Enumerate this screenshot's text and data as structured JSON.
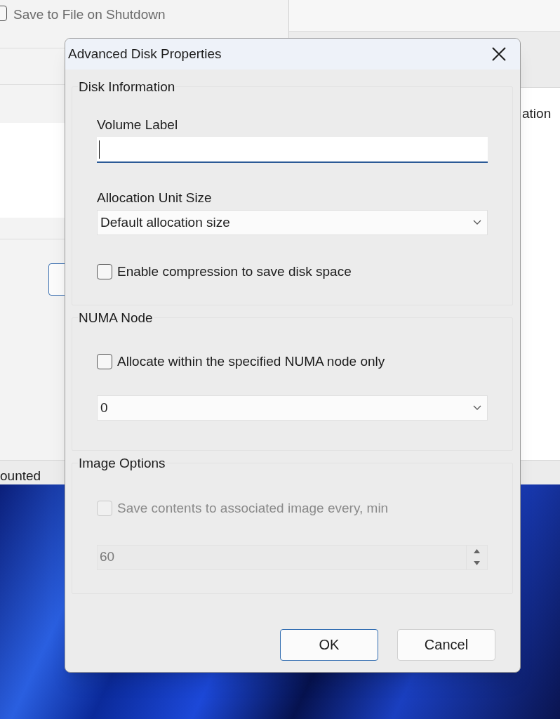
{
  "background": {
    "left_window": {
      "checkbox": {
        "label": "Save to File on Shutdown",
        "checked": false
      },
      "status_text": "ounted"
    },
    "right_window": {
      "text": "ation"
    }
  },
  "dialog": {
    "title": "Advanced Disk Properties",
    "groups": [
      {
        "title": "Disk Information",
        "items": [
          {
            "kind": "text_field",
            "label": "Volume Label",
            "focused": true
          },
          {
            "kind": "dropdown",
            "label": "Allocation Unit Size",
            "value": "Default allocation size"
          },
          {
            "kind": "checkbox",
            "label": "Enable compression to save disk space",
            "checked": false,
            "disabled": false
          }
        ]
      },
      {
        "title": "NUMA Node",
        "items": [
          {
            "kind": "checkbox",
            "label": "Allocate within the specified NUMA node only",
            "checked": false,
            "disabled": false
          },
          {
            "kind": "dropdown",
            "value": "0"
          }
        ]
      },
      {
        "title": "Image Options",
        "items": [
          {
            "kind": "checkbox",
            "label": "Save contents to associated image every, min",
            "checked": false,
            "disabled": true
          },
          {
            "kind": "spinner",
            "value": "60",
            "disabled": true
          }
        ]
      }
    ],
    "buttons": [
      {
        "label": "OK",
        "default": true
      },
      {
        "label": "Cancel",
        "default": false
      }
    ]
  }
}
